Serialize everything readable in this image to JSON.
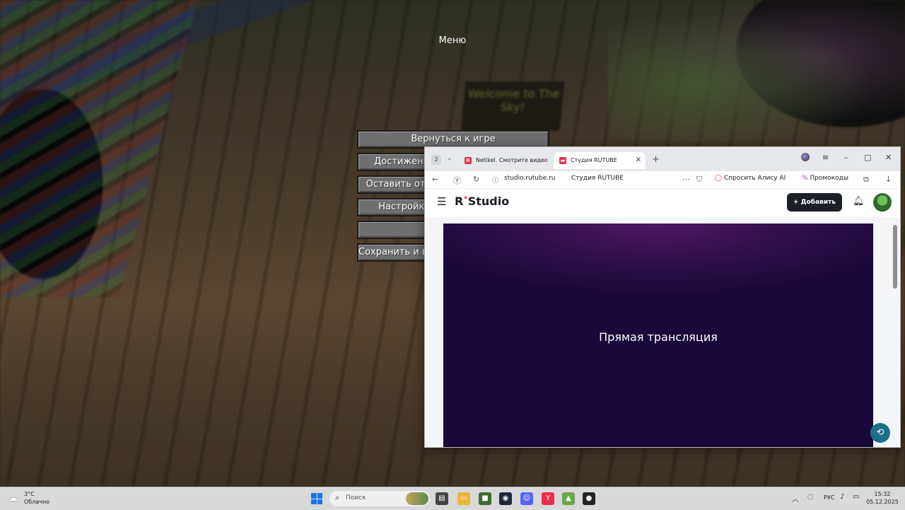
{
  "game": {
    "menu_title": "Меню",
    "sign_text": "Welcome to The Sky!",
    "buttons": {
      "back_to_game": "Вернуться к игре",
      "achievements": "Достижения",
      "feedback": "Оставить отзыв",
      "settings": "Настройки",
      "hidden": "",
      "save": "Сохранить и выйти"
    }
  },
  "browser": {
    "tab_count": "2",
    "tabs": [
      {
        "label": "Netikel. Смотрите видео с",
        "favicon_color": "#e8304a"
      },
      {
        "label": "Студия RUTUBE",
        "favicon_color": "#e8304a"
      }
    ],
    "address": {
      "url": "studio.rutube.ru",
      "page_title": "Студия RUTUBE",
      "alice_button": "Спросить Алису AI",
      "promo_button": "Промокоды"
    }
  },
  "studio": {
    "logo_mark": "R",
    "logo_text": "Studio",
    "add_button": "Добавить",
    "live_title": "Прямая трансляция"
  },
  "taskbar": {
    "weather_temp": "3°C",
    "weather_desc": "Облачно",
    "search_placeholder": "Поиск",
    "lang": "РУС",
    "time": "15:32",
    "date": "05.12.2025"
  },
  "colors": {
    "accent": "#ff2f4f",
    "player_bg": "#1a0838",
    "add_button_bg": "#1c1f26"
  }
}
